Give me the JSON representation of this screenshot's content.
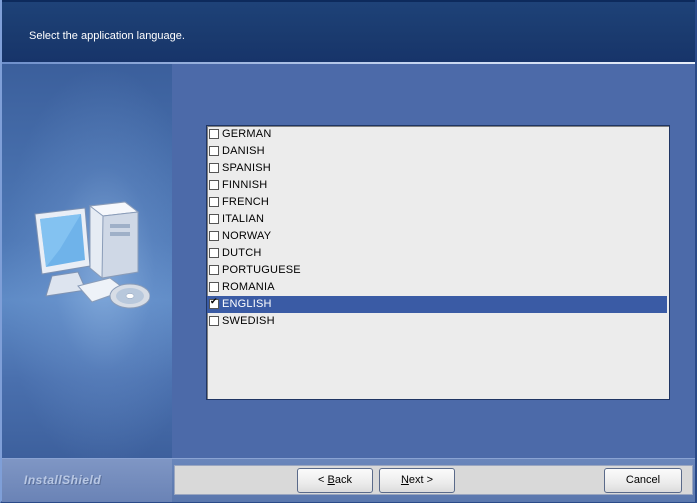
{
  "header": {
    "instruction": "Select the application language."
  },
  "languages": [
    {
      "label": "GERMAN",
      "checked": false
    },
    {
      "label": "DANISH",
      "checked": false
    },
    {
      "label": "SPANISH",
      "checked": false
    },
    {
      "label": "FINNISH",
      "checked": false
    },
    {
      "label": "FRENCH",
      "checked": false
    },
    {
      "label": "ITALIAN",
      "checked": false
    },
    {
      "label": "NORWAY",
      "checked": false
    },
    {
      "label": "DUTCH",
      "checked": false
    },
    {
      "label": "PORTUGUESE",
      "checked": false
    },
    {
      "label": "ROMANIA",
      "checked": false
    },
    {
      "label": "ENGLISH",
      "checked": true,
      "selected": true
    },
    {
      "label": "SWEDISH",
      "checked": false
    }
  ],
  "footer": {
    "brand": "InstallShield",
    "back": {
      "prefix": "< ",
      "mnemonic": "B",
      "rest": "ack"
    },
    "next": {
      "mnemonic": "N",
      "rest": "ext >"
    },
    "cancel": "Cancel"
  },
  "colors": {
    "header": "#1a3a6e",
    "selection": "#3a5ba5",
    "panel": "#4c6aa9"
  },
  "icons": {
    "side_graphic": "computer-with-cd-icon"
  }
}
